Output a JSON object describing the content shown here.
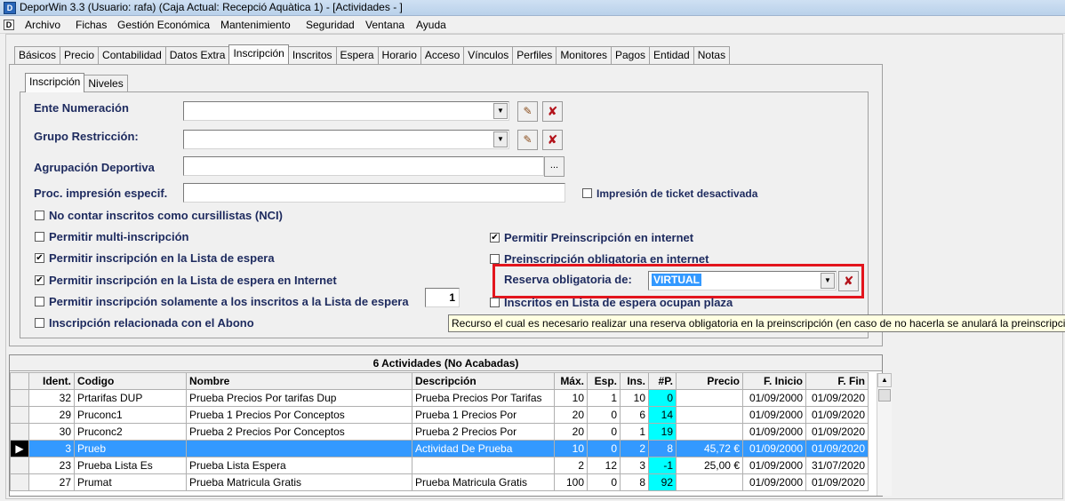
{
  "window": {
    "title": "DeporWin 3.3  (Usuario: rafa)  (Caja Actual: Recepció Aquàtica 1) - [Actividades - ]",
    "app_icon": "D"
  },
  "menu": [
    "Archivo",
    "Fichas",
    "Gestión Económica",
    "Mantenimiento",
    "Seguridad",
    "Ventana",
    "Ayuda"
  ],
  "main_tabs": [
    "Básicos",
    "Precio",
    "Contabilidad",
    "Datos Extra",
    "Inscripción",
    "Inscritos",
    "Espera",
    "Horario",
    "Acceso",
    "Vínculos",
    "Perfiles",
    "Monitores",
    "Pagos",
    "Entidad",
    "Notas"
  ],
  "sub_tabs": [
    "Inscripción",
    "Niveles"
  ],
  "form": {
    "ente_numeracion": {
      "label": "Ente Numeración",
      "value": ""
    },
    "grupo_restriccion": {
      "label": "Grupo Restricción:",
      "value": ""
    },
    "agrupacion_deportiva": {
      "label": "Agrupación Deportiva",
      "value": "",
      "button": "..."
    },
    "proc_impresion": {
      "label": "Proc. impresión especif.",
      "value": ""
    },
    "impresion_ticket": {
      "label": "Impresión de ticket desactivada",
      "checked": false
    },
    "no_contar": {
      "label": "No contar inscritos como cursillistas (NCI)",
      "checked": false
    },
    "multi_inscripcion": {
      "label": "Permitir multi-inscripción",
      "checked": false
    },
    "lista_espera": {
      "label": "Permitir inscripción en la Lista de espera",
      "checked": true
    },
    "lista_espera_internet": {
      "label": "Permitir inscripción en la Lista de espera en Internet",
      "checked": true
    },
    "solo_lista_espera": {
      "label": "Permitir inscripción solamente a los inscritos a la Lista de espera",
      "checked": false,
      "value": "1"
    },
    "relacionada_abono": {
      "label": "Inscripción relacionada con el Abono",
      "checked": false
    },
    "preinscripcion_internet": {
      "label": "Permitir Preinscripción en internet",
      "checked": true
    },
    "preinscripcion_obligatoria": {
      "label": "Preinscripción obligatoria en internet",
      "checked": false
    },
    "reserva_obligatoria": {
      "label": "Reserva obligatoria de:",
      "value": "VIRTUAL"
    },
    "inscritos_lista_espera": {
      "label": "Inscritos en Lista de espera ocupan plaza",
      "checked": false
    }
  },
  "tooltip": "Recurso el cual es necesario realizar una reserva obligatoria en la preinscripción (en caso de no hacerla se anulará la preinscripción)",
  "grid": {
    "caption": "6 Actividades  (No Acabadas)",
    "columns": [
      "Ident.",
      "Codigo",
      "Nombre",
      "Descripción",
      "Máx.",
      "Esp.",
      "Ins.",
      "#P.",
      "Precio",
      "F. Inicio",
      "F. Fin"
    ],
    "rows": [
      [
        "32",
        "Prtarifas DUP",
        "Prueba Precios Por  tarifas Dup",
        "Prueba Precios Por Tarifas",
        "10",
        "1",
        "10",
        "0",
        "",
        "01/09/2000",
        "01/09/2020"
      ],
      [
        "29",
        "Pruconc1",
        "Prueba 1 Precios Por Conceptos",
        "Prueba 1 Precios Por",
        "20",
        "0",
        "6",
        "14",
        "",
        "01/09/2000",
        "01/09/2020"
      ],
      [
        "30",
        "Pruconc2",
        "Prueba 2 Precios Por Conceptos",
        "Prueba 2 Precios Por",
        "20",
        "0",
        "1",
        "19",
        "",
        "01/09/2000",
        "01/09/2020"
      ],
      [
        "3",
        "Prueb",
        "",
        "Actividad De Prueba",
        "10",
        "0",
        "2",
        "8",
        "45,72 €",
        "01/09/2000",
        "01/09/2020"
      ],
      [
        "23",
        "Prueba Lista Es",
        "Prueba Lista Espera",
        "",
        "2",
        "12",
        "3",
        "-1",
        "25,00 €",
        "01/09/2000",
        "31/07/2020"
      ],
      [
        "27",
        "Prumat",
        "Prueba Matricula Gratis",
        "Prueba Matricula Gratis",
        "100",
        "0",
        "8",
        "92",
        "",
        "01/09/2000",
        "01/09/2020"
      ]
    ],
    "selected_row": 3
  },
  "colors": {
    "highlight": "#e3151d",
    "selection": "#3399ff",
    "cyan": "#00ffff",
    "label": "#1d2a5e"
  }
}
